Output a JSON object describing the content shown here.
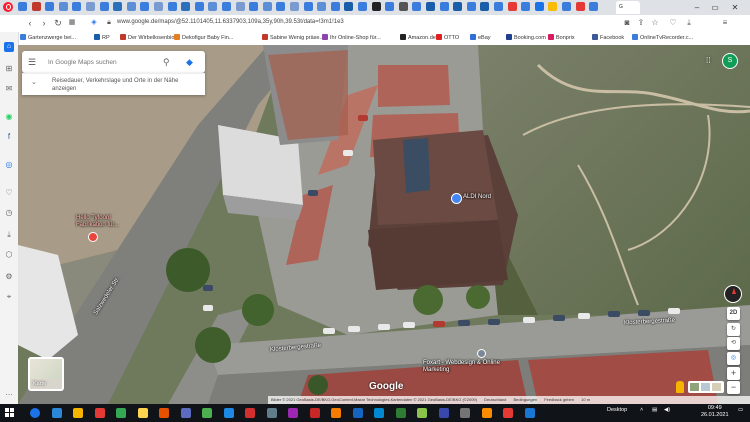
{
  "browser": {
    "active_tab_label": "G",
    "url": "www.google.de/maps/@52.1101405,11.6337903,109a,35y,90h,39.53t/data=!3m1!1e3",
    "bookmarks": [
      {
        "label": "Gartenzwerge bei...",
        "color": "#3b7ddd"
      },
      {
        "label": "RP",
        "color": "#1a5da8"
      },
      {
        "label": "Der Wirbellosenbio...",
        "color": "#c0392b"
      },
      {
        "label": "Dekofigur Baby Fin...",
        "color": "#e67e22"
      },
      {
        "label": "Sabine Wenig präse...",
        "color": "#c0392b"
      },
      {
        "label": "Ihr Online-Shop für...",
        "color": "#8e44ad"
      },
      {
        "label": "Amazon.de",
        "color": "#222222"
      },
      {
        "label": "OTTO",
        "color": "#e02020"
      },
      {
        "label": "eBay",
        "color": "#2f6fd6"
      },
      {
        "label": "Booking.com",
        "color": "#1f3f8f"
      },
      {
        "label": "Bonprix",
        "color": "#d81b60"
      },
      {
        "label": "Facebook",
        "color": "#3b5998"
      },
      {
        "label": "OnlineTvRecorder.c...",
        "color": "#3b7ddd"
      }
    ]
  },
  "search": {
    "placeholder": "In Google Maps suchen",
    "subtitle": "Reisedauer, Verkehrslage und Orte in der Nähe anzeigen"
  },
  "map": {
    "places": {
      "aldi": "ALDI Nord",
      "hello": "Hello Tyfoon! Fabrikation für...",
      "foxart": "Foxart - Webdesign & Online Marketing"
    },
    "streets": {
      "left": "Salzwedeler Str.",
      "main": "Klosterbergestraße",
      "right": "Klosterbergestraße"
    },
    "layer_label": "Karte",
    "google_logo": "Google",
    "mode_2d": "2D",
    "attribution": "Bilder © 2021 GeoBasis-DE/BKG,GeoContent,Maxar Technologies,Kartendaten © 2021 GeoBasis-DE/BKG (©2009)",
    "country": "Deutschland",
    "terms": "Bedingungen",
    "feedback": "Feedback geben",
    "scale": "10 m"
  },
  "taskbar": {
    "desktop": "Desktop",
    "time": "09:49",
    "date": "26.01.2021"
  },
  "account_initial": "S"
}
